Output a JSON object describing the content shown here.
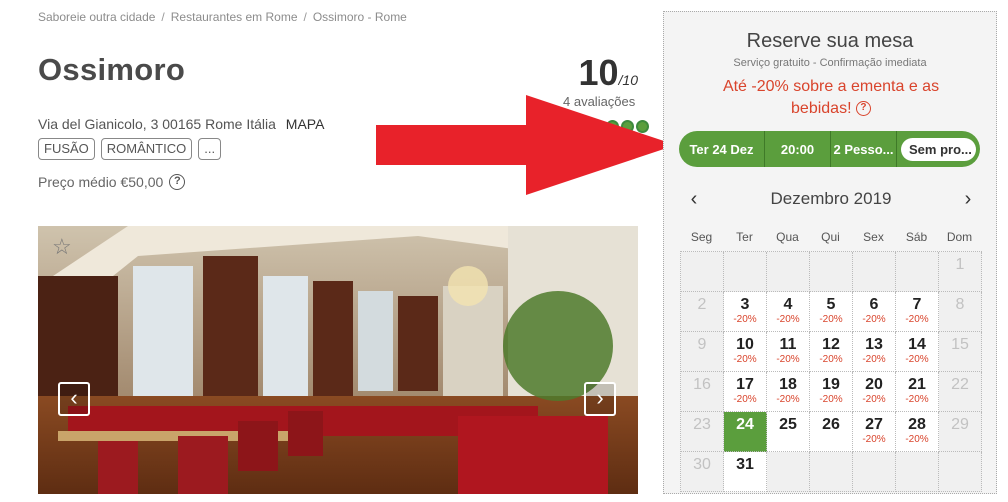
{
  "breadcrumb": [
    "Saboreie outra cidade",
    "Restaurantes em Rome",
    "Ossimoro - Rome"
  ],
  "breadcrumb_sep": "/",
  "restaurant": {
    "name": "Ossimoro",
    "address": "Via del Gianicolo, 3 00165 Rome Itália",
    "map_link": "MAPA",
    "tags": [
      "FUSÃO",
      "ROMÂNTICO",
      "..."
    ],
    "price": "Preço médio €50,00",
    "rating": "10",
    "rating_max": "/10",
    "reviews": "4 avaliações",
    "rating_dots": 5
  },
  "gallery": {
    "prev_icon": "chevron-left-icon",
    "next_icon": "chevron-right-icon",
    "prev": "‹",
    "next": "›",
    "favorite": "☆"
  },
  "booking": {
    "title": "Reserve sua mesa",
    "subtitle": "Serviço gratuito - Confirmação imediata",
    "promo": "Até -20% sobre a ementa e as bebidas!",
    "help": "?",
    "date": "Ter 24 Dez",
    "time": "20:00",
    "people": "2 Pesso...",
    "offer": "Sem pro..."
  },
  "calendar": {
    "month": "Dezembro 2019",
    "prev": "‹",
    "next": "›",
    "weekdays": [
      "Seg",
      "Ter",
      "Qua",
      "Qui",
      "Sex",
      "Sáb",
      "Dom"
    ],
    "weeks": [
      [
        {
          "n": "",
          "off": true
        },
        {
          "n": "",
          "off": true
        },
        {
          "n": "",
          "off": true
        },
        {
          "n": "",
          "off": true
        },
        {
          "n": "",
          "off": true
        },
        {
          "n": "",
          "off": true
        },
        {
          "n": "1",
          "off": true
        }
      ],
      [
        {
          "n": "2",
          "off": true
        },
        {
          "n": "3",
          "d": "-20%"
        },
        {
          "n": "4",
          "d": "-20%"
        },
        {
          "n": "5",
          "d": "-20%"
        },
        {
          "n": "6",
          "d": "-20%"
        },
        {
          "n": "7",
          "d": "-20%"
        },
        {
          "n": "8",
          "off": true
        }
      ],
      [
        {
          "n": "9",
          "off": true
        },
        {
          "n": "10",
          "d": "-20%"
        },
        {
          "n": "11",
          "d": "-20%"
        },
        {
          "n": "12",
          "d": "-20%"
        },
        {
          "n": "13",
          "d": "-20%"
        },
        {
          "n": "14",
          "d": "-20%"
        },
        {
          "n": "15",
          "off": true
        }
      ],
      [
        {
          "n": "16",
          "off": true
        },
        {
          "n": "17",
          "d": "-20%"
        },
        {
          "n": "18",
          "d": "-20%"
        },
        {
          "n": "19",
          "d": "-20%"
        },
        {
          "n": "20",
          "d": "-20%"
        },
        {
          "n": "21",
          "d": "-20%"
        },
        {
          "n": "22",
          "off": true
        }
      ],
      [
        {
          "n": "23",
          "off": true
        },
        {
          "n": "24",
          "sel": true
        },
        {
          "n": "25"
        },
        {
          "n": "26"
        },
        {
          "n": "27",
          "d": "-20%"
        },
        {
          "n": "28",
          "d": "-20%"
        },
        {
          "n": "29",
          "off": true
        }
      ],
      [
        {
          "n": "30",
          "off": true
        },
        {
          "n": "31"
        },
        {
          "n": "",
          "empty": true
        },
        {
          "n": "",
          "empty": true
        },
        {
          "n": "",
          "empty": true
        },
        {
          "n": "",
          "empty": true
        },
        {
          "n": "",
          "empty": true
        }
      ]
    ]
  },
  "colors": {
    "accent": "#5b9e3d",
    "promo": "#d9442c",
    "arrow": "#e8222a"
  }
}
